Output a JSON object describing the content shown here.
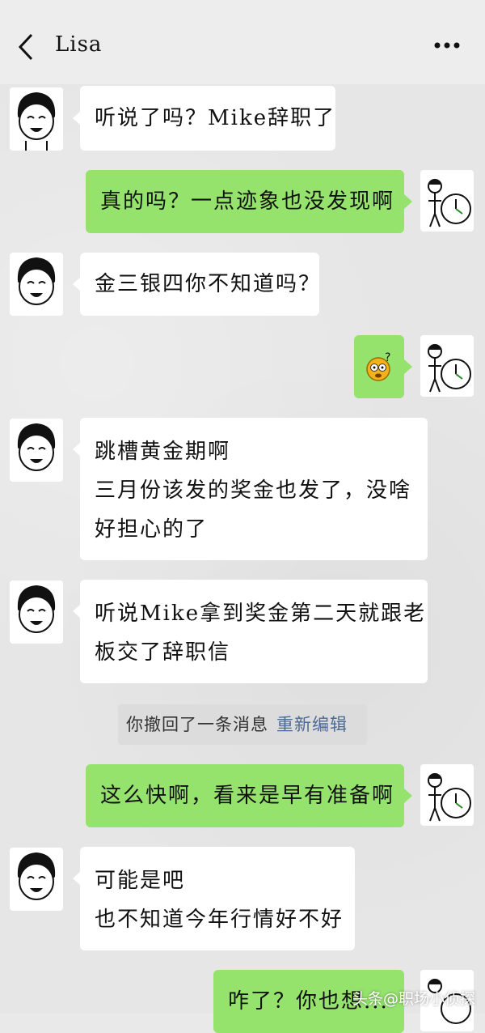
{
  "header": {
    "title": "Lisa",
    "back_icon": "chevron-left-icon",
    "more_icon": "more-dots-icon"
  },
  "messages": [
    {
      "side": "in",
      "lines": [
        "听说了吗？Mike辞职了"
      ]
    },
    {
      "side": "out",
      "lines": [
        "真的吗？一点迹象也没发现啊"
      ]
    },
    {
      "side": "in",
      "lines": [
        "金三银四你不知道吗？"
      ]
    },
    {
      "side": "out",
      "lines": [],
      "emoji": "dizzy-question-emoji"
    },
    {
      "side": "in",
      "lines": [
        "跳槽黄金期啊",
        "三月份该发的奖金也发了，没啥",
        "好担心的了"
      ]
    },
    {
      "side": "in",
      "lines": [
        "听说Mike拿到奖金第二天就跟老",
        "板交了辞职信"
      ]
    },
    {
      "side": "out",
      "lines": [
        "这么快啊，看来是早有准备啊"
      ]
    },
    {
      "side": "in",
      "lines": [
        "可能是吧",
        "也不知道今年行情好不好"
      ]
    },
    {
      "side": "out",
      "lines": [
        "咋了？你也想..."
      ]
    }
  ],
  "system_notice": {
    "text": "你撤回了一条消息",
    "link": "重新编辑"
  },
  "watermark": "头条@职场小侦探"
}
